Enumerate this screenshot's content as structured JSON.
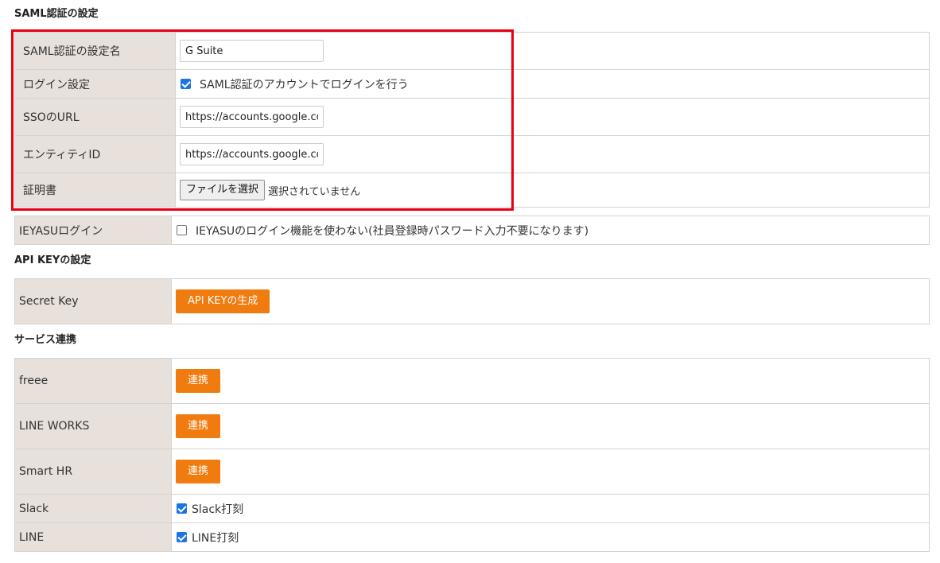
{
  "saml_section": {
    "title": "SAML認証の設定",
    "rows": {
      "setting_name": {
        "label": "SAML認証の設定名",
        "value": "G Suite"
      },
      "login_setting": {
        "label": "ログイン設定",
        "checkbox_label": "SAML認証のアカウントでログインを行う",
        "checked": true
      },
      "sso_url": {
        "label": "SSOのURL",
        "value": "https://accounts.google.co"
      },
      "entity_id": {
        "label": "エンティティID",
        "value": "https://accounts.google.co"
      },
      "certificate": {
        "label": "証明書",
        "button_label": "ファイルを選択",
        "status": "選択されていません"
      }
    }
  },
  "ieyasu_login": {
    "label": "IEYASUログイン",
    "checkbox_label": "IEYASUのログイン機能を使わない(社員登録時パスワード入力不要になります)",
    "checked": false
  },
  "api_section": {
    "title": "API KEYの設定",
    "secret_key": {
      "label": "Secret Key",
      "button_label": "API KEYの生成"
    }
  },
  "service_section": {
    "title": "サービス連携",
    "freee": {
      "label": "freee",
      "button_label": "連携"
    },
    "line_works": {
      "label": "LINE WORKS",
      "button_label": "連携"
    },
    "smart_hr": {
      "label": "Smart HR",
      "button_label": "連携"
    },
    "slack": {
      "label": "Slack",
      "checkbox_label": "Slack打刻",
      "checked": true
    },
    "line": {
      "label": "LINE",
      "checkbox_label": "LINE打刻",
      "checked": true
    }
  },
  "colors": {
    "label_bg": "#e8e0da",
    "accent_orange": "#f07b0e",
    "highlight_red": "#e60012",
    "checkbox_blue": "#1a73e8"
  }
}
